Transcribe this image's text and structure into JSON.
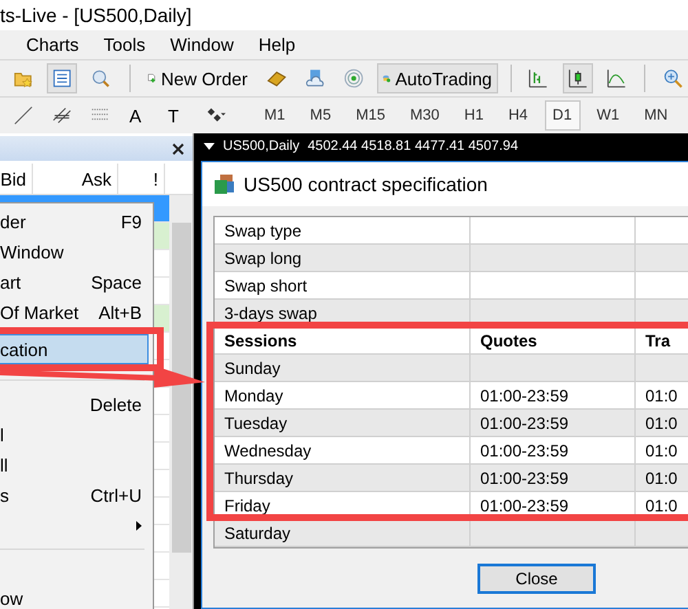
{
  "window": {
    "title": "ts-Live - [US500,Daily]"
  },
  "menu": [
    "Charts",
    "Tools",
    "Window",
    "Help"
  ],
  "toolbar": {
    "new_order": "New Order",
    "autotrading": "AutoTrading",
    "autotrading_on": true
  },
  "text_tools": [
    "A",
    "T"
  ],
  "timeframes": [
    {
      "label": "M1",
      "selected": false
    },
    {
      "label": "M5",
      "selected": false
    },
    {
      "label": "M15",
      "selected": false
    },
    {
      "label": "M30",
      "selected": false
    },
    {
      "label": "H1",
      "selected": false
    },
    {
      "label": "H4",
      "selected": false
    },
    {
      "label": "D1",
      "selected": true
    },
    {
      "label": "W1",
      "selected": false
    },
    {
      "label": "MN",
      "selected": false
    }
  ],
  "market_watch": {
    "columns": [
      "Bid",
      "Ask",
      "!"
    ]
  },
  "context_menu": {
    "items": [
      {
        "kind": "item",
        "label": "der",
        "shortcut": "F9",
        "selected": false
      },
      {
        "kind": "item",
        "label": "Window",
        "selected": false
      },
      {
        "kind": "item",
        "label": "art",
        "shortcut": "Space",
        "selected": false
      },
      {
        "kind": "item",
        "label": "Of Market",
        "shortcut": "Alt+B",
        "selected": false
      },
      {
        "kind": "item",
        "label": "cation",
        "selected": true
      },
      {
        "kind": "separator"
      },
      {
        "kind": "item",
        "shortcut": "Delete",
        "selected": false
      },
      {
        "kind": "item",
        "label": "l",
        "selected": false
      },
      {
        "kind": "item",
        "label": "ll",
        "selected": false
      },
      {
        "kind": "item",
        "label": "s",
        "shortcut": "Ctrl+U",
        "selected": false
      },
      {
        "kind": "submenu",
        "selected": false
      },
      {
        "kind": "separator"
      },
      {
        "kind": "blank"
      },
      {
        "kind": "item",
        "label": "ow",
        "selected": false
      }
    ]
  },
  "chart": {
    "symbol": "US500,Daily",
    "prices": "4502.44 4518.81 4477.41 4507.94"
  },
  "dialog": {
    "title": "US500 contract specification",
    "rows": [
      {
        "kind": "row",
        "cells": [
          "Swap type"
        ]
      },
      {
        "kind": "row",
        "cells": [
          "Swap long"
        ]
      },
      {
        "kind": "row",
        "cells": [
          "Swap short"
        ]
      },
      {
        "kind": "row",
        "cells": [
          "3-days swap"
        ]
      },
      {
        "kind": "header",
        "cells": [
          "Sessions",
          "Quotes",
          "Tra"
        ]
      },
      {
        "kind": "row",
        "cells": [
          "Sunday"
        ]
      },
      {
        "kind": "row",
        "cells": [
          "Monday",
          "01:00-23:59",
          "01:0"
        ]
      },
      {
        "kind": "row",
        "cells": [
          "Tuesday",
          "01:00-23:59",
          "01:0"
        ]
      },
      {
        "kind": "row",
        "cells": [
          "Wednesday",
          "01:00-23:59",
          "01:0"
        ]
      },
      {
        "kind": "row",
        "cells": [
          "Thursday",
          "01:00-23:59",
          "01:0"
        ]
      },
      {
        "kind": "row",
        "cells": [
          "Friday",
          "01:00-23:59",
          "01:0"
        ]
      },
      {
        "kind": "row",
        "cells": [
          "Saturday"
        ]
      }
    ],
    "close_button": "Close"
  }
}
